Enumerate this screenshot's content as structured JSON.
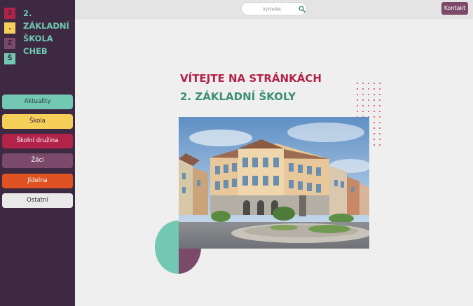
{
  "sidebar": {
    "logo_letters": [
      "2",
      ".",
      "Z",
      "Š"
    ],
    "school_name_line1": "2. ZÁKLADNÍ",
    "school_name_line2": "ŠKOLA CHEB",
    "nav_items": [
      {
        "label": "Aktuality",
        "color": "#72c8b2"
      },
      {
        "label": "Škola",
        "color": "#f6cf58"
      },
      {
        "label": "Školní družina",
        "color": "#b2234a"
      },
      {
        "label": "Žáci",
        "color": "#7b4a6b"
      },
      {
        "label": "Jídelna",
        "color": "#df5323"
      },
      {
        "label": "Ostatní",
        "color": "#e9e9e9"
      }
    ]
  },
  "header": {
    "search_placeholder": "Vyhledat",
    "search_icon": "search-icon",
    "contact_label": "Kontakt"
  },
  "main": {
    "welcome_line1": "VÍTEJTE NA STRÁNKÁCH",
    "welcome_line2": "2. ZÁKLADNÍ ŠKOLY"
  },
  "colors": {
    "sidebar_bg": "#3d2a42",
    "accent_red": "#b2234a",
    "accent_green": "#3c8f72",
    "accent_teal": "#72c8b2",
    "accent_purple": "#7b4a6b",
    "page_bg": "#efefef"
  }
}
